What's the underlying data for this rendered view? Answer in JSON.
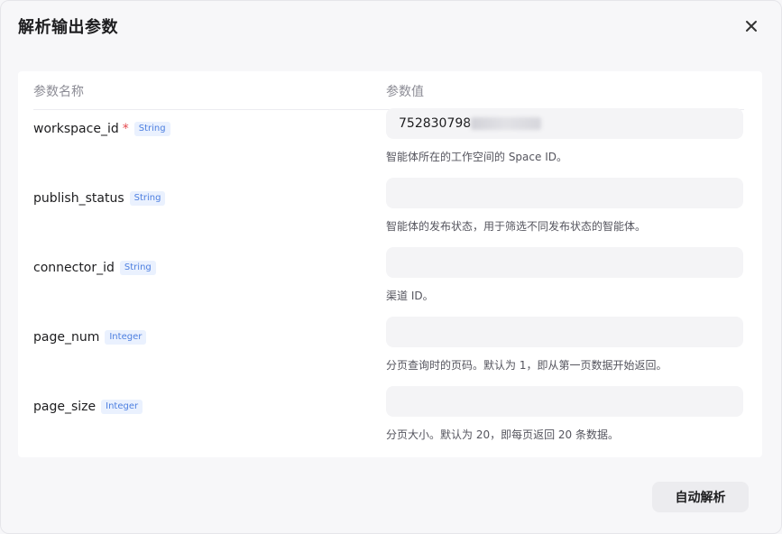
{
  "dialog": {
    "title": "解析输出参数",
    "close_icon": "close-icon"
  },
  "table": {
    "col_name_header": "参数名称",
    "col_value_header": "参数值",
    "rows": [
      {
        "name": "workspace_id",
        "required": "*",
        "type": "String",
        "value": "752830798",
        "value_partially_masked": true,
        "description": "智能体所在的工作空间的 Space ID。"
      },
      {
        "name": "publish_status",
        "required": "",
        "type": "String",
        "value": "",
        "description": "智能体的发布状态，用于筛选不同发布状态的智能体。"
      },
      {
        "name": "connector_id",
        "required": "",
        "type": "String",
        "value": "",
        "description": "渠道 ID。"
      },
      {
        "name": "page_num",
        "required": "",
        "type": "Integer",
        "value": "",
        "description": "分页查询时的页码。默认为 1，即从第一页数据开始返回。"
      },
      {
        "name": "page_size",
        "required": "",
        "type": "Integer",
        "value": "",
        "description": "分页大小。默认为 20，即每页返回 20 条数据。"
      }
    ]
  },
  "footer": {
    "auto_parse_label": "自动解析"
  },
  "colors": {
    "dialog_bg": "#f7f7f9",
    "panel_bg": "#ffffff",
    "input_bg": "#f4f4f6",
    "badge_text": "#4d7fe0",
    "badge_bg": "#eaf1fe",
    "required": "#e5484d"
  }
}
